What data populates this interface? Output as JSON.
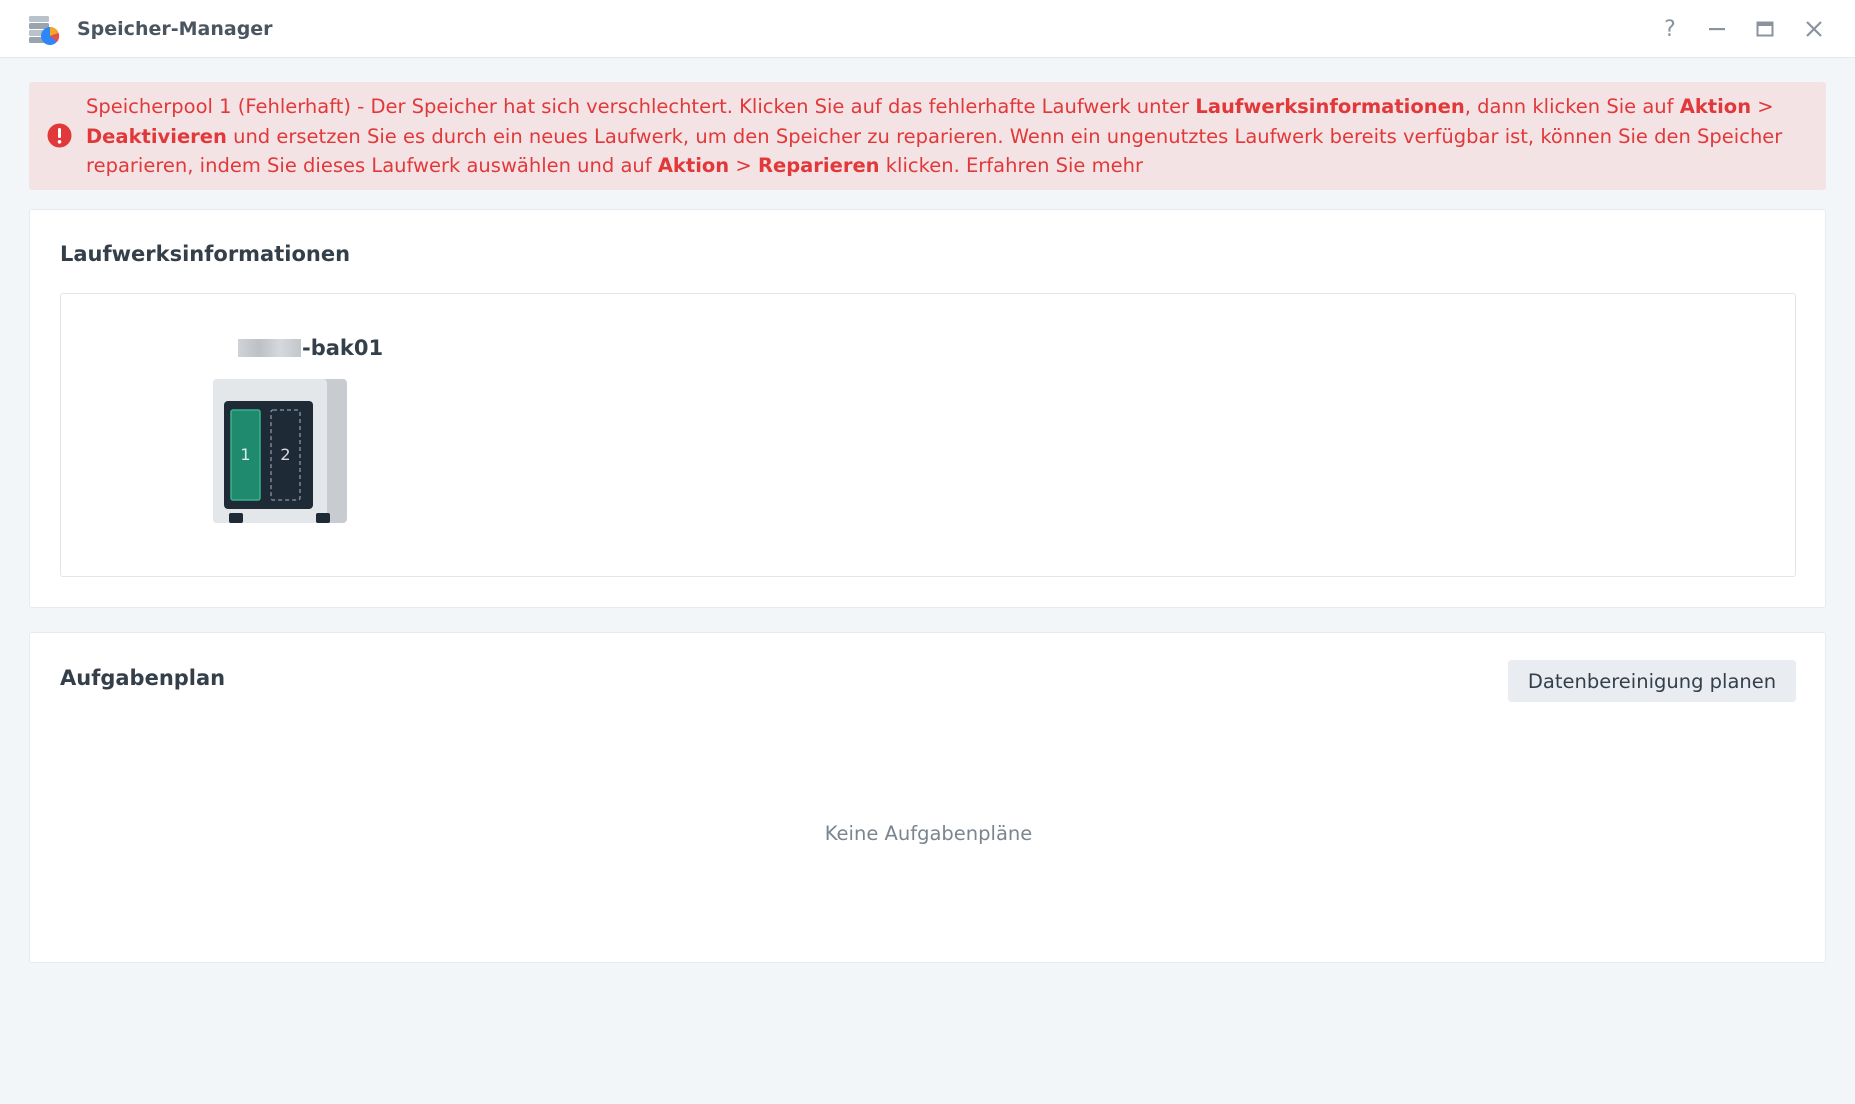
{
  "window": {
    "title": "Speicher-Manager",
    "controls": {
      "help": "?"
    }
  },
  "alert": {
    "part1": "Speicherpool 1 (Fehlerhaft) - Der Speicher hat sich verschlechtert. Klicken Sie auf das fehlerhafte Laufwerk unter ",
    "link_drive_info": "Laufwerksinformationen",
    "part2": ", dann klicken Sie auf ",
    "action1": "Aktion",
    "sep1": " > ",
    "deactivate": "Deaktivieren",
    "part3": " und ersetzen Sie es durch ein neues Laufwerk, um den Speicher zu reparieren. Wenn ein ungenutztes Laufwerk bereits verfügbar ist, können Sie den Speicher reparieren, indem Sie dieses Laufwerk auswählen und auf ",
    "action2": "Aktion",
    "sep2": " > ",
    "repair": "Reparieren",
    "part4": " klicken. ",
    "learn_more": "Erfahren Sie mehr"
  },
  "drive_info": {
    "title": "Laufwerksinformationen",
    "device_suffix": "-bak01",
    "bays": [
      {
        "label": "1",
        "status": "installed",
        "color": "#1f8a6e"
      },
      {
        "label": "2",
        "status": "empty"
      }
    ]
  },
  "task_plan": {
    "title": "Aufgabenplan",
    "schedule_button": "Datenbereinigung planen",
    "empty_text": "Keine Aufgabenpläne"
  },
  "colors": {
    "alert_text": "#e1383a",
    "alert_bg": "#f4e3e4",
    "background": "#f3f6f9"
  }
}
